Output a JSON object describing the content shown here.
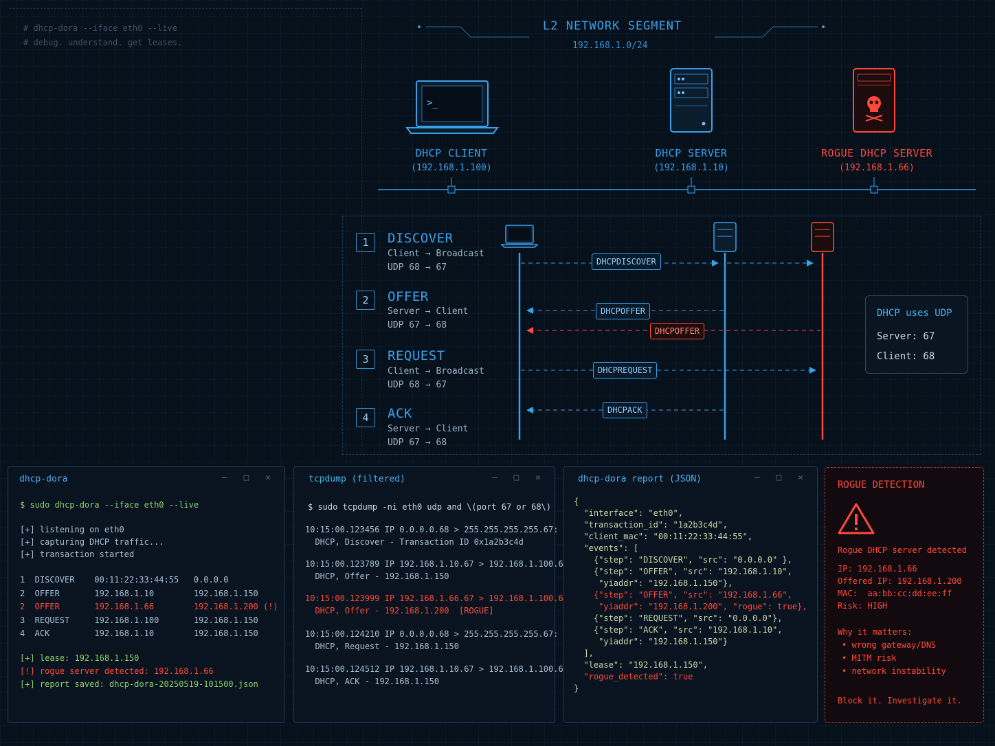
{
  "comment": {
    "line1": "# dhcp-dora --iface eth0 --live",
    "line2": "# debug. understand. get leases."
  },
  "network": {
    "title": "L2 NETWORK SEGMENT",
    "subnet": "192.168.1.0/24",
    "devices": [
      {
        "label": "DHCP CLIENT",
        "ip": "(192.168.1.100)",
        "color": "#3aa0e8"
      },
      {
        "label": "DHCP SERVER",
        "ip": "(192.168.1.10)",
        "color": "#3aa0e8"
      },
      {
        "label": "ROGUE DHCP SERVER",
        "ip": "(192.168.1.66)",
        "color": "#ff4a3a"
      }
    ]
  },
  "dora": {
    "steps": [
      {
        "num": "1",
        "name": "DISCOVER",
        "line1": "Client → Broadcast",
        "line2": "UDP 68 → 67"
      },
      {
        "num": "2",
        "name": "OFFER",
        "line1": "Server → Client",
        "line2": "UDP 67 → 68"
      },
      {
        "num": "3",
        "name": "REQUEST",
        "line1": "Client → Broadcast",
        "line2": "UDP 68 → 67"
      },
      {
        "num": "4",
        "name": "ACK",
        "line1": "Server → Client",
        "line2": "UDP 67 → 68"
      }
    ],
    "messages": {
      "discover": "DHCPDISCOVER",
      "offer": "DHCPOFFER",
      "rogue_offer": "DHCPOFFER",
      "request": "DHCPREQUEST",
      "ack": "DHCPACK"
    },
    "udp_box": {
      "title": "DHCP uses UDP",
      "server": "Server: 67",
      "client": "Client: 68"
    }
  },
  "terminal1": {
    "title": "dhcp-dora",
    "cmd": "$ sudo dhcp-dora --iface eth0 --live",
    "log1": "[+] listening on eth0",
    "log2": "[+] capturing DHCP traffic...",
    "log3": "[+] transaction started",
    "rows": [
      "1  DISCOVER    00:11:22:33:44:55   0.0.0.0",
      "2  OFFER       192.168.1.10        192.168.1.150",
      "2  OFFER       192.168.1.66        192.168.1.200 (!)",
      "3  REQUEST     192.168.1.100       192.168.1.150",
      "4  ACK         192.168.1.10        192.168.1.150"
    ],
    "lease": "[+] lease: 192.168.1.150",
    "rogue": "[!] rogue server detected: 192.168.1.66",
    "saved": "[+] report saved: dhcp-dora-20250519-101500.json"
  },
  "terminal2": {
    "title": "tcpdump  (filtered)",
    "cmd": "$ sudo tcpdump -ni eth0 udp and \\(port 67 or 68\\)",
    "p1a": "10:15:00.123456 IP 0.0.0.0.68 > 255.255.255.255.67:",
    "p1b": "  DHCP, Discover - Transaction ID 0x1a2b3c4d",
    "p2a": "10:15:00.123789 IP 192.168.1.10.67 > 192.168.1.100.68:",
    "p2b": "  DHCP, Offer - 192.168.1.150",
    "p3a": "10:15:00.123999 IP 192.168.1.66.67 > 192.168.1.100.68:",
    "p3b": "  DHCP, Offer - 192.168.1.200  [ROGUE]",
    "p4a": "10:15:00.124210 IP 0.0.0.0.68 > 255.255.255.255.67:",
    "p4b": "  DHCP, Request - 192.168.1.150",
    "p5a": "10:15:00.124512 IP 192.168.1.10.67 > 192.168.1.100.68:",
    "p5b": "  DHCP, ACK - 192.168.1.150"
  },
  "terminal3": {
    "title": "dhcp-dora report (JSON)",
    "j01": "{",
    "j02": "  \"interface\": \"eth0\",",
    "j03": "  \"transaction_id\": \"1a2b3c4d\",",
    "j04": "  \"client_mac\": \"00:11:22:33:44:55\",",
    "j05": "  \"events\": [",
    "j06": "    {\"step\": \"DISCOVER\", \"src\": \"0.0.0.0\" },",
    "j07": "    {\"step\": \"OFFER\", \"src\": \"192.168.1.10\",",
    "j08": "     \"yiaddr\": \"192.168.1.150\"},",
    "j09": "    {\"step\": \"OFFER\", \"src\": \"192.168.1.66\",",
    "j10": "     \"yiaddr\": \"192.168.1.200\", \"rogue\": true},",
    "j11": "    {\"step\": \"REQUEST\", \"src\": \"0.0.0.0\"},",
    "j12": "    {\"step\": \"ACK\", \"src\": \"192.168.1.10\",",
    "j13": "     \"yiaddr\": \"192.168.1.150\"}",
    "j14": "  ],",
    "j15": "  \"lease\": \"192.168.1.150\",",
    "j16": "  \"rogue_detected\": true",
    "j17": "}"
  },
  "rogue_detection": {
    "title": "ROGUE DETECTION",
    "detected": "Rogue DHCP server detected",
    "ip": "IP: 192.168.1.66",
    "offered": "Offered IP: 192.168.1.200",
    "mac": "MAC:  aa:bb:cc:dd:ee:ff",
    "risk": "Risk: HIGH",
    "why": "Why it matters:",
    "b1": "• wrong gateway/DNS",
    "b2": "• MITM risk",
    "b3": "• network instability",
    "footer": "Block it. Investigate it."
  }
}
